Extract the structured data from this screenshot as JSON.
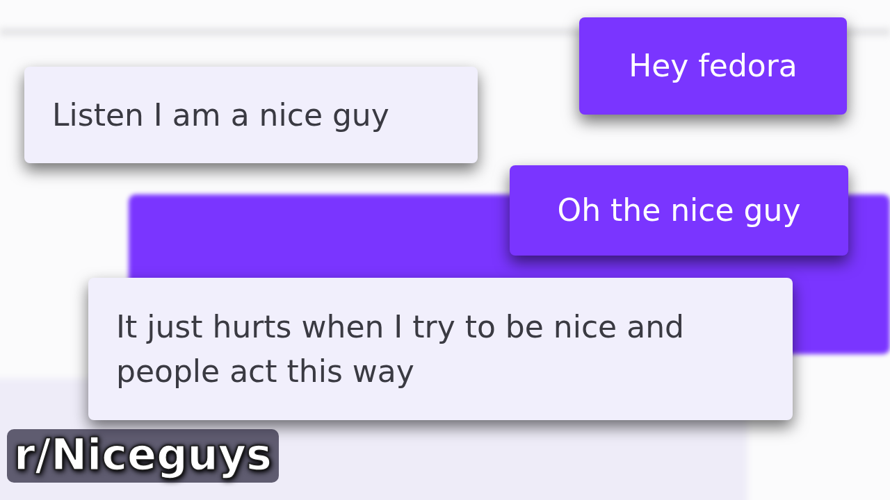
{
  "messages": [
    {
      "text": "Hey fedora",
      "kind": "sent"
    },
    {
      "text": "Listen I am a nice guy",
      "kind": "received"
    },
    {
      "text": "Oh the nice guy",
      "kind": "sent"
    },
    {
      "text": "It just hurts when I try to be nice and people act this way",
      "kind": "received"
    }
  ],
  "caption": "r/Niceguys"
}
